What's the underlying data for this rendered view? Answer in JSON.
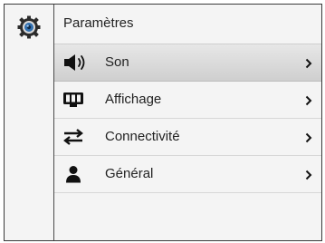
{
  "header": {
    "title": "Paramètres"
  },
  "left_icon": "settings-camera-icon",
  "menu": {
    "items": [
      {
        "label": "Son",
        "icon": "speaker-icon",
        "selected": true
      },
      {
        "label": "Affichage",
        "icon": "monitor-icon",
        "selected": false
      },
      {
        "label": "Connectivité",
        "icon": "transfer-arrows-icon",
        "selected": false
      },
      {
        "label": "Général",
        "icon": "person-icon",
        "selected": false
      }
    ]
  },
  "colors": {
    "selected_bg_top": "#e7e7e7",
    "selected_bg_bottom": "#cfcfcf",
    "accent_blue": "#2f6fb0"
  }
}
